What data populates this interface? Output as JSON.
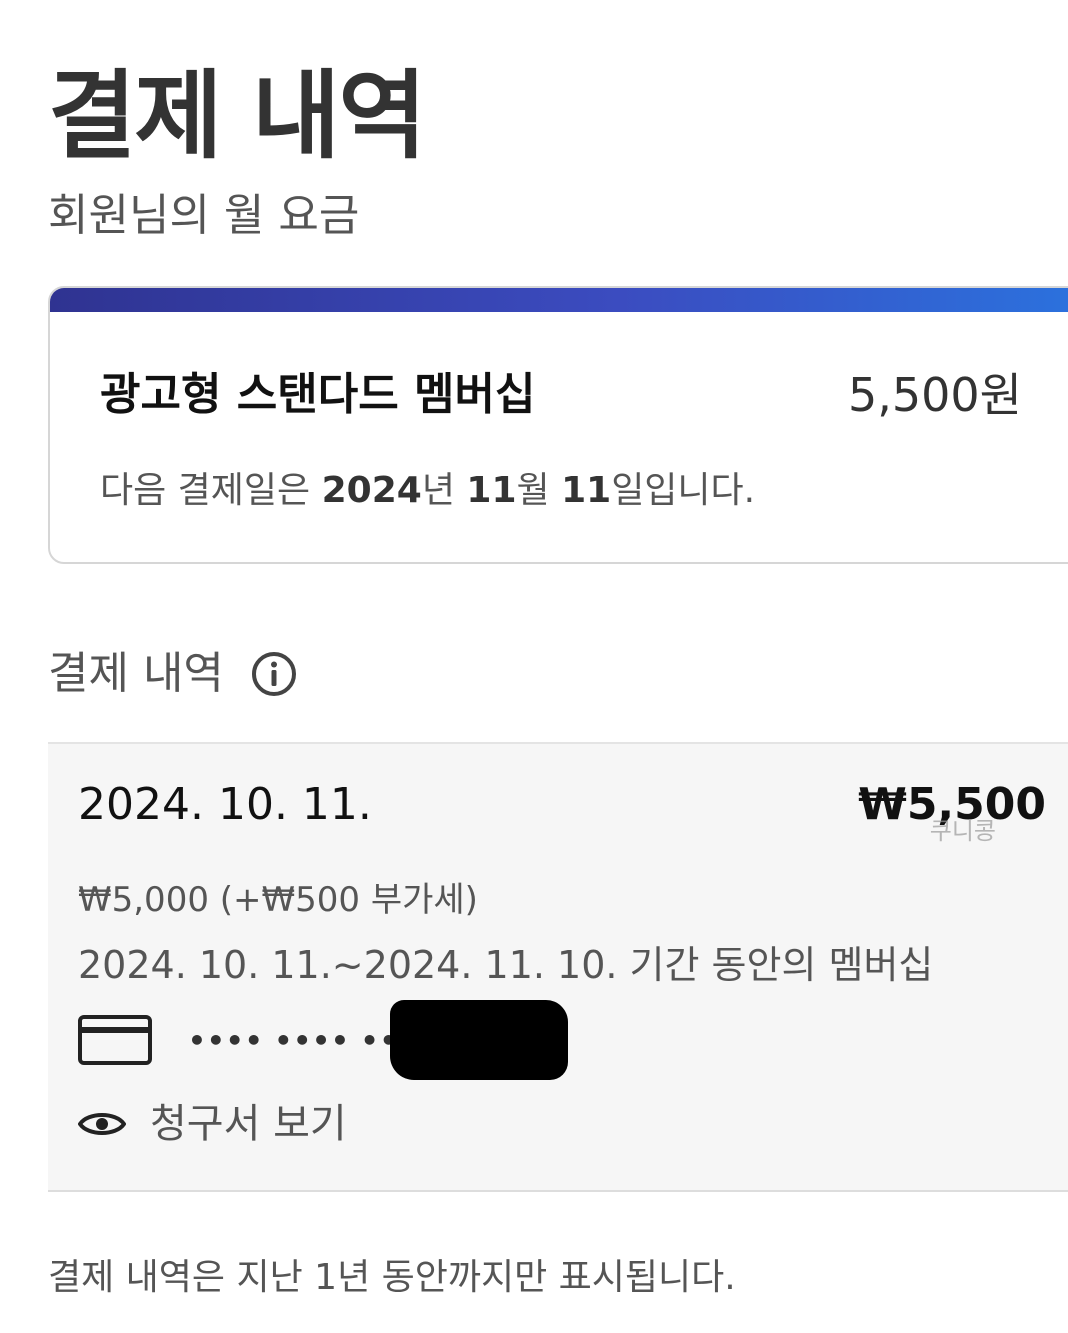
{
  "page": {
    "title": "결제 내역"
  },
  "monthly_fee": {
    "heading": "회원님의 월 요금",
    "plan_name": "광고형 스탠다드 멤버십",
    "plan_price": "5,500원",
    "next_billing_prefix": "다음 결제일은 ",
    "next_billing_year": "2024",
    "next_billing_year_unit": "년 ",
    "next_billing_month": "11",
    "next_billing_month_unit": "월 ",
    "next_billing_day": "11",
    "next_billing_suffix": "일입니다."
  },
  "history": {
    "heading": "결제 내역",
    "info_icon": "info-circle-icon",
    "entries": [
      {
        "date": "2024. 10. 11.",
        "amount": "₩5,500",
        "breakdown": "₩5,000 (+₩500 부가세)",
        "period": "2024. 10. 11.~2024. 11. 10. 기간 동안의 멤버십",
        "card_icon": "credit-card-icon",
        "card_mask": "•••• •••• ••••",
        "invoice_icon": "eye-icon",
        "invoice_label": "청구서 보기"
      }
    ],
    "watermark": "쿠니콩"
  },
  "footer": {
    "note": "결제 내역은 지난 1년 동안까지만 표시됩니다."
  },
  "colors": {
    "accent_gradient_start": "#2f3391",
    "accent_gradient_end": "#2b72de",
    "panel_background": "#f6f6f6"
  }
}
